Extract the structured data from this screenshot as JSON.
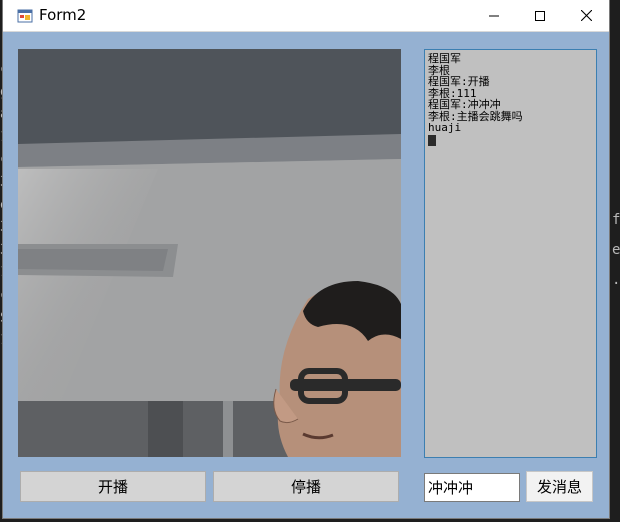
{
  "window": {
    "title": "Form2"
  },
  "background_text": {
    "left": [
      "c",
      "g",
      "a",
      "1",
      "c",
      "3",
      "e",
      "3",
      "3",
      "1",
      "c",
      "S",
      "1"
    ],
    "right": [
      "f",
      "e",
      "."
    ]
  },
  "chat": {
    "lines": [
      "程国军",
      "李根",
      "程国军:开播",
      "李根:111",
      "程国军:冲冲冲",
      "李根:主播会跳舞吗",
      "huaji"
    ]
  },
  "controls": {
    "start_label": "开播",
    "stop_label": "停播",
    "message_value": "冲冲冲",
    "send_label": "发消息"
  }
}
